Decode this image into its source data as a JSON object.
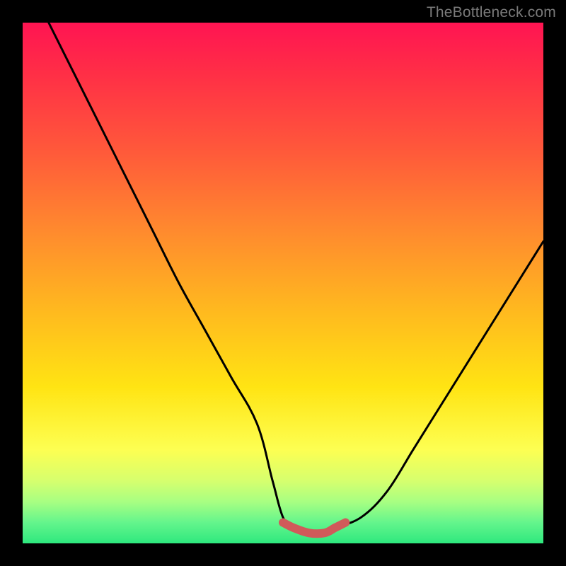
{
  "watermark": "TheBottleneck.com",
  "chart_data": {
    "type": "line",
    "title": "",
    "xlabel": "",
    "ylabel": "",
    "xlim": [
      0,
      100
    ],
    "ylim": [
      0,
      100
    ],
    "series": [
      {
        "name": "bottleneck-curve",
        "x": [
          5,
          10,
          15,
          20,
          25,
          30,
          35,
          40,
          45,
          48,
          50,
          52,
          55,
          58,
          60,
          65,
          70,
          75,
          80,
          85,
          90,
          95,
          100
        ],
        "values": [
          100,
          90,
          80,
          70,
          60,
          50,
          41,
          32,
          23,
          12,
          5,
          3,
          2,
          2,
          3,
          5,
          10,
          18,
          26,
          34,
          42,
          50,
          58
        ]
      },
      {
        "name": "bottleneck-flat-highlight",
        "x": [
          50,
          52,
          55,
          58,
          60,
          62
        ],
        "values": [
          4,
          3,
          2,
          2,
          3,
          4
        ]
      }
    ],
    "gradient_stops": [
      {
        "pos": 0,
        "color": "#ff1452"
      },
      {
        "pos": 25,
        "color": "#ff5a3a"
      },
      {
        "pos": 55,
        "color": "#ffb81f"
      },
      {
        "pos": 82,
        "color": "#fdff52"
      },
      {
        "pos": 100,
        "color": "#2ee87e"
      }
    ]
  }
}
